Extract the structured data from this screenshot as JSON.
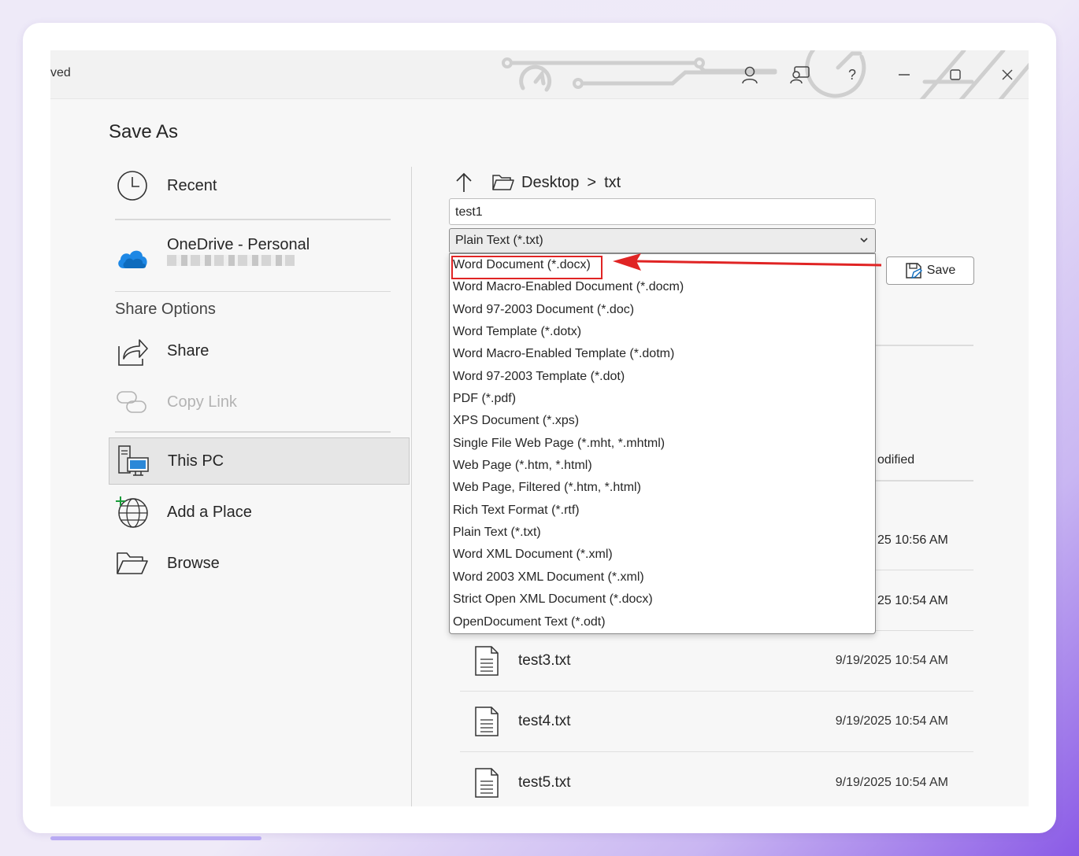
{
  "window": {
    "title_fragment": "ved"
  },
  "titlebar_buttons": [
    {
      "icon": "account-icon"
    },
    {
      "icon": "coauthor-icon"
    },
    {
      "icon": "help-icon",
      "label": "?"
    },
    {
      "icon": "minimize-icon"
    },
    {
      "icon": "maximize-icon"
    },
    {
      "icon": "close-icon"
    }
  ],
  "page": {
    "title": "Save As"
  },
  "nav": {
    "recent": "Recent",
    "onedrive": "OneDrive - Personal",
    "share_options": "Share Options",
    "share": "Share",
    "copy_link": "Copy Link",
    "this_pc": "This PC",
    "add_place": "Add a Place",
    "browse": "Browse"
  },
  "location": {
    "crumbs": [
      "Desktop",
      "txt"
    ],
    "separator": ">"
  },
  "filename": {
    "value": "test1"
  },
  "filetype": {
    "selected": "Plain Text (*.txt)"
  },
  "dropdown": {
    "options": [
      "Word Document (*.docx)",
      "Word Macro-Enabled Document (*.docm)",
      "Word 97-2003 Document (*.doc)",
      "Word Template (*.dotx)",
      "Word Macro-Enabled Template (*.dotm)",
      "Word 97-2003 Template (*.dot)",
      "PDF (*.pdf)",
      "XPS Document (*.xps)",
      "Single File Web Page (*.mht, *.mhtml)",
      "Web Page (*.htm, *.html)",
      "Web Page, Filtered (*.htm, *.html)",
      "Rich Text Format (*.rtf)",
      "Plain Text (*.txt)",
      "Word XML Document (*.xml)",
      "Word 2003 XML Document (*.xml)",
      "Strict Open XML Document (*.docx)",
      "OpenDocument Text (*.odt)"
    ],
    "highlighted": "Word Document (*.docx)"
  },
  "save_button": {
    "label": "Save"
  },
  "file_list": {
    "header_fragment": "odified",
    "partial_dates": [
      "25 10:56 AM",
      "25 10:54 AM"
    ],
    "files": [
      {
        "name": "test3.txt",
        "date": "9/19/2025 10:54 AM"
      },
      {
        "name": "test4.txt",
        "date": "9/19/2025 10:54 AM"
      },
      {
        "name": "test5.txt",
        "date": "9/19/2025 10:54 AM"
      }
    ]
  },
  "colors": {
    "accent_red": "#e02424",
    "onedrive_blue": "#0f6cbd",
    "page_background": "#f7f7f7"
  }
}
